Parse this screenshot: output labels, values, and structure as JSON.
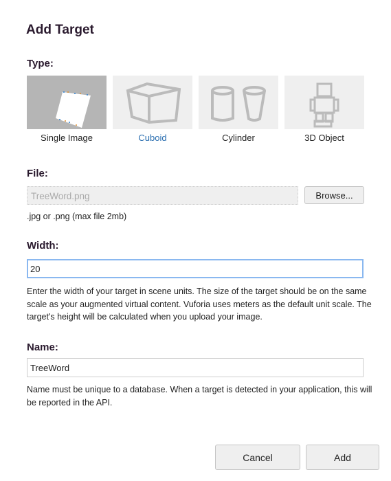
{
  "dialog": {
    "title": "Add Target"
  },
  "type": {
    "label": "Type:",
    "options": [
      {
        "label": "Single Image",
        "selected": true
      },
      {
        "label": "Cuboid",
        "selected": false
      },
      {
        "label": "Cylinder",
        "selected": false
      },
      {
        "label": "3D Object",
        "selected": false
      }
    ]
  },
  "file": {
    "label": "File:",
    "value": "TreeWord.png",
    "browse_label": "Browse...",
    "hint": ".jpg or .png (max file 2mb)"
  },
  "width": {
    "label": "Width:",
    "value": "20",
    "help": "Enter the width of your target in scene units. The size of the target should be on the same scale as your augmented virtual content. Vuforia uses meters as the default unit scale. The target's height will be calculated when you upload your image."
  },
  "name": {
    "label": "Name:",
    "value": "TreeWord",
    "help": "Name must be unique to a database. When a target is detected in your application, this will be reported in the API."
  },
  "buttons": {
    "cancel": "Cancel",
    "add": "Add"
  }
}
